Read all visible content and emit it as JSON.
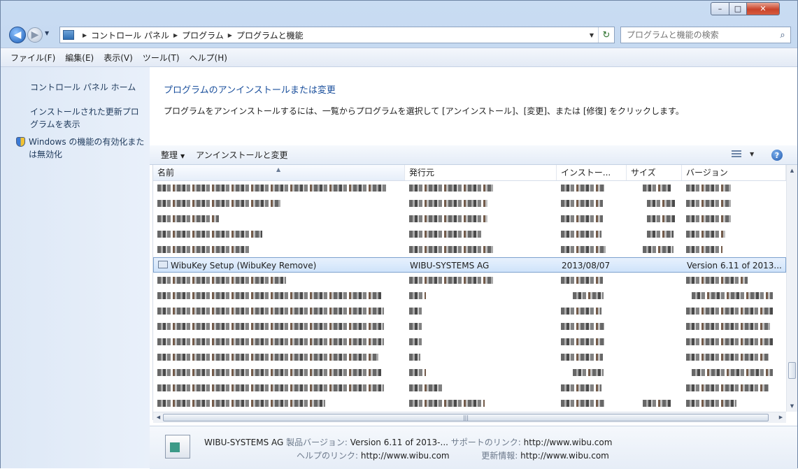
{
  "window": {
    "minimize_label": "–",
    "maximize_label": "□",
    "close_label": "✕"
  },
  "nav": {
    "back_label": "◀",
    "forward_label": "▶",
    "breadcrumbs": [
      "コントロール パネル",
      "プログラム",
      "プログラムと機能"
    ],
    "search_placeholder": "プログラムと機能の検索",
    "refresh_label": "↻"
  },
  "menubar": [
    "ファイル(F)",
    "編集(E)",
    "表示(V)",
    "ツール(T)",
    "ヘルプ(H)"
  ],
  "leftpane": {
    "home": "コントロール パネル ホーム",
    "updates": "インストールされた更新プログラムを表示",
    "features": "Windows の機能の有効化または無効化"
  },
  "main": {
    "heading": "プログラムのアンインストールまたは変更",
    "description": "プログラムをアンインストールするには、一覧からプログラムを選択して [アンインストール]、[変更]、または [修復] をクリックします。"
  },
  "toolbar": {
    "organize": "整理",
    "uninstall_change": "アンインストールと変更",
    "help": "?"
  },
  "columns": {
    "name": "名前",
    "publisher": "発行元",
    "installed": "インストー...",
    "size": "サイズ",
    "version": "バージョン"
  },
  "selected_row": {
    "name": "WibuKey Setup (WibuKey Remove)",
    "publisher": "WIBU-SYSTEMS AG",
    "installed": "2013/08/07",
    "version": "Version 6.11 of 2013..."
  },
  "details": {
    "publisher": "WIBU-SYSTEMS AG",
    "product_version_label": "製品バージョン:",
    "product_version": "Version 6.11 of 2013-...",
    "support_link_label": "サポートのリンク:",
    "support_link": "http://www.wibu.com",
    "help_link_label": "ヘルプのリンク:",
    "help_link": "http://www.wibu.com",
    "update_info_label": "更新情報:",
    "update_info": "http://www.wibu.com"
  },
  "colors": {
    "heading_link": "#1a4f9c",
    "selection": "#cfe3fa",
    "left_pane": "#dde8f6"
  }
}
